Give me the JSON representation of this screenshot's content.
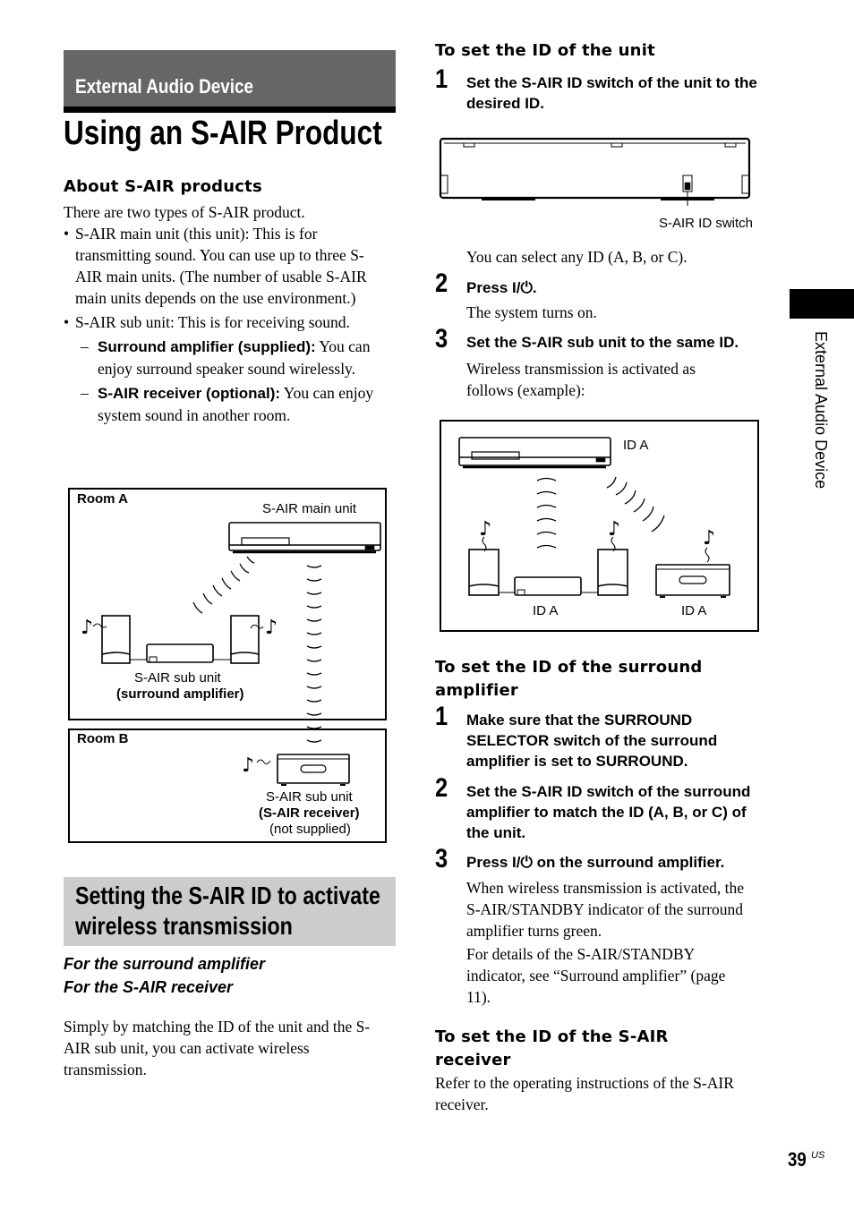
{
  "header": {
    "section": "External Audio Device",
    "title": "Using an S-AIR Product"
  },
  "about": {
    "heading": "About S-AIR products",
    "intro": "There are two types of S-AIR product.",
    "bullets": [
      "S-AIR main unit (this unit): This is for transmitting sound. You can use up to three S-AIR main units. (The number of usable S-AIR main units depends on the use environment.)",
      "S-AIR sub unit: This is for receiving sound."
    ],
    "sub_items": [
      {
        "dash": "–",
        "bold": "Surround amplifier (supplied):",
        "text": " You can enjoy surround speaker sound wirelessly."
      },
      {
        "dash": "–",
        "bold": "S-AIR receiver (optional):",
        "text": " You can enjoy system sound in another room."
      }
    ]
  },
  "figure1": {
    "room_a": "Room A",
    "room_b": "Room B",
    "main_unit": "S-AIR main unit",
    "sub_unit_a_line1": "S-AIR sub unit",
    "sub_unit_a_line2": "(surround amplifier)",
    "sub_unit_b_line1": "S-AIR sub unit",
    "sub_unit_b_line2": "(S-AIR receiver)",
    "sub_unit_b_line3": "(not supplied)"
  },
  "section2": {
    "title": "Setting the S-AIR ID to activate wireless transmission",
    "applies_1": "For the surround amplifier",
    "applies_2": "For the S-AIR receiver",
    "body": "Simply by matching the ID of the unit and the S-AIR sub unit, you can activate wireless transmission."
  },
  "set_unit": {
    "heading": "To set the ID of the unit",
    "steps": [
      {
        "num": "1",
        "text": "Set the S-AIR ID switch of the unit to the desired ID."
      },
      {
        "num": "2",
        "text": "Press I/⏻.",
        "note": "The system turns on."
      },
      {
        "num": "3",
        "text": "Set the S-AIR sub unit to the same ID.",
        "note": "Wireless transmission is activated as follows (example):"
      }
    ],
    "switch_label": "S-AIR ID switch",
    "select_note": "You can select any ID (A, B, or C)."
  },
  "figure2": {
    "id_main": "ID A",
    "id_amp": "ID A",
    "id_receiver": "ID A"
  },
  "set_amp": {
    "heading": "To set the ID of the surround amplifier",
    "steps": [
      {
        "num": "1",
        "text": "Make sure that the SURROUND SELECTOR switch of the surround amplifier is set to SURROUND."
      },
      {
        "num": "2",
        "text": "Set the S-AIR ID switch of the surround amplifier to match the ID (A, B, or C) of the unit."
      },
      {
        "num": "3",
        "text": "Press I/⏻ on the surround amplifier.",
        "note": "When wireless transmission is activated, the S-AIR/STANDBY indicator of the surround amplifier turns green.",
        "note2": "For details of the S-AIR/STANDBY indicator, see “Surround amplifier” (page 11)."
      }
    ]
  },
  "set_receiver": {
    "heading": "To set the ID of the S-AIR receiver",
    "body": "Refer to the operating instructions of the S-AIR receiver."
  },
  "side_tab": {
    "label": "External Audio Device"
  },
  "footer": {
    "page": "39",
    "region": "US"
  }
}
